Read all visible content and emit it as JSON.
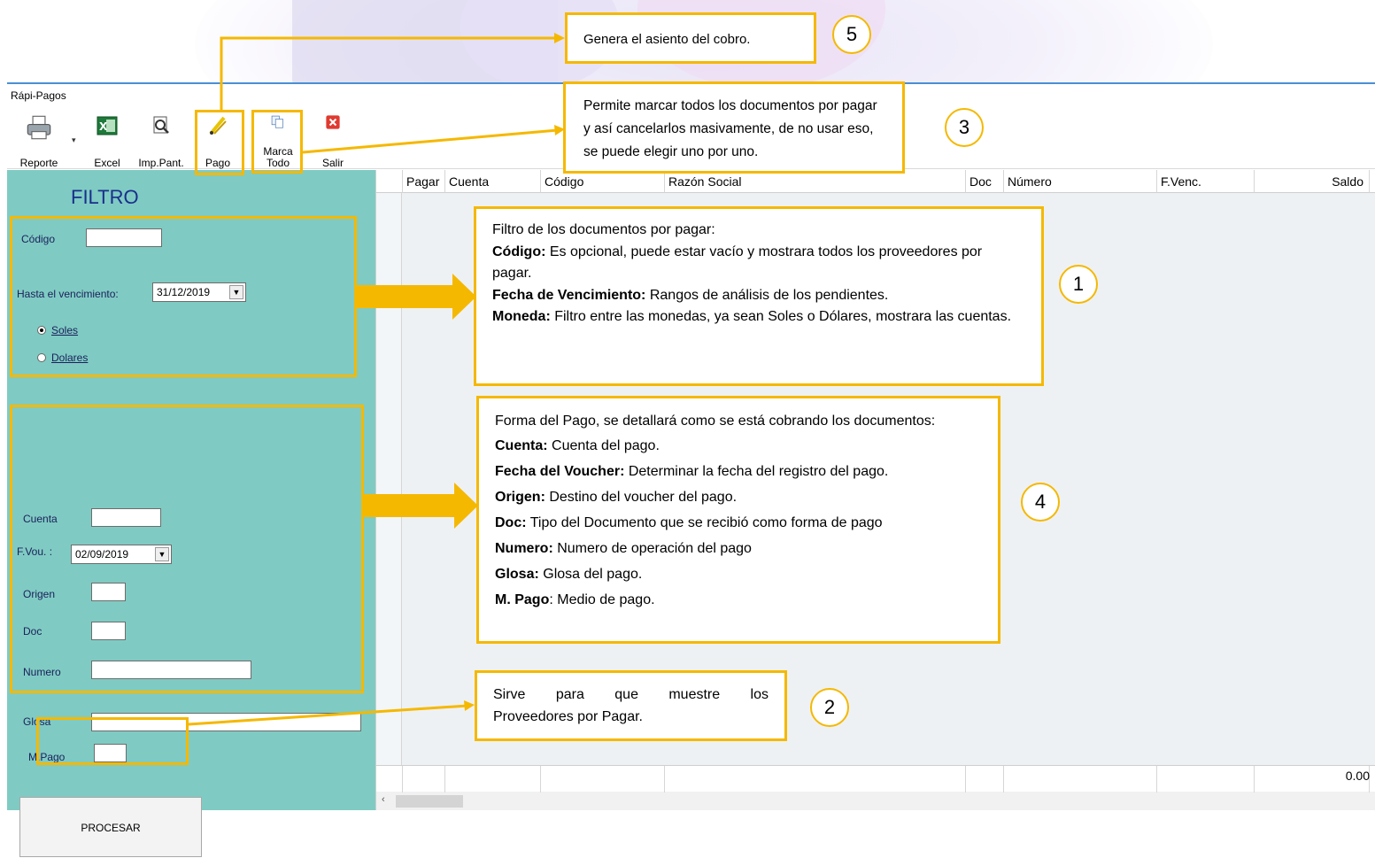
{
  "window": {
    "title": "Rápi-Pagos"
  },
  "toolbar": {
    "reporte": "Reporte",
    "excel": "Excel",
    "imp_pant": "Imp.Pant.",
    "pago": "Pago",
    "marca_todo_1": "Marca",
    "marca_todo_2": "Todo",
    "salir": "Salir"
  },
  "filter": {
    "title": "FILTRO",
    "codigo_label": "Código",
    "codigo_value": "",
    "hasta_label": "Hasta el vencimiento:",
    "hasta_value": "31/12/2019",
    "currency_options": [
      "Soles",
      "Dolares"
    ],
    "currency_selected": "Soles"
  },
  "payment": {
    "cuenta_label": "Cuenta",
    "fvou_label": "F.Vou. :",
    "fvou_value": "02/09/2019",
    "origen_label": "Origen",
    "doc_label": "Doc",
    "numero_label": "Numero",
    "glosa_label": "Glosa",
    "mpago_label": "M.Pago",
    "procesar": "PROCESAR"
  },
  "grid": {
    "columns": [
      "Pagar",
      "Cuenta",
      "Código",
      "Razón Social",
      "Doc",
      "Número",
      "F.Venc.",
      "Saldo"
    ],
    "total": "0.00"
  },
  "callouts": {
    "c5": {
      "number": "5",
      "text": "Genera el asiento del cobro."
    },
    "c3": {
      "number": "3",
      "text": "Permite marcar todos los documentos por pagar y así cancelarlos masivamente, de no usar eso, se puede elegir uno por uno."
    },
    "c1": {
      "number": "1",
      "intro": "Filtro de los documentos por pagar:",
      "codigo_b": "Código:",
      "codigo_t": " Es opcional, puede estar vacío y mostrara todos los proveedores por pagar.",
      "fecha_b": "Fecha de Vencimiento:",
      "fecha_t": " Rangos de análisis de los pendientes.",
      "moneda_b": "Moneda:",
      "moneda_t": " Filtro entre las monedas, ya sean Soles o Dólares, mostrara las cuentas."
    },
    "c4": {
      "number": "4",
      "intro": "Forma del Pago, se detallará como se está cobrando los documentos:",
      "cuenta_b": "Cuenta:",
      "cuenta_t": " Cuenta del pago.",
      "fecha_b": "Fecha del Voucher:",
      "fecha_t": " Determinar la fecha del registro del pago.",
      "origen_b": "Origen:",
      "origen_t": " Destino del voucher del pago.",
      "doc_b": "Doc:",
      "doc_t": " Tipo del Documento que se recibió como forma de pago",
      "numero_b": "Numero:",
      "numero_t": " Numero de operación del pago",
      "glosa_b": "Glosa:",
      "glosa_t": " Glosa del pago.",
      "mpago_b": "M. Pago",
      "mpago_t": ": Medio de pago."
    },
    "c2": {
      "number": "2",
      "text_1": "Sirve para que muestre los",
      "text_2": "Proveedores por Pagar."
    }
  }
}
